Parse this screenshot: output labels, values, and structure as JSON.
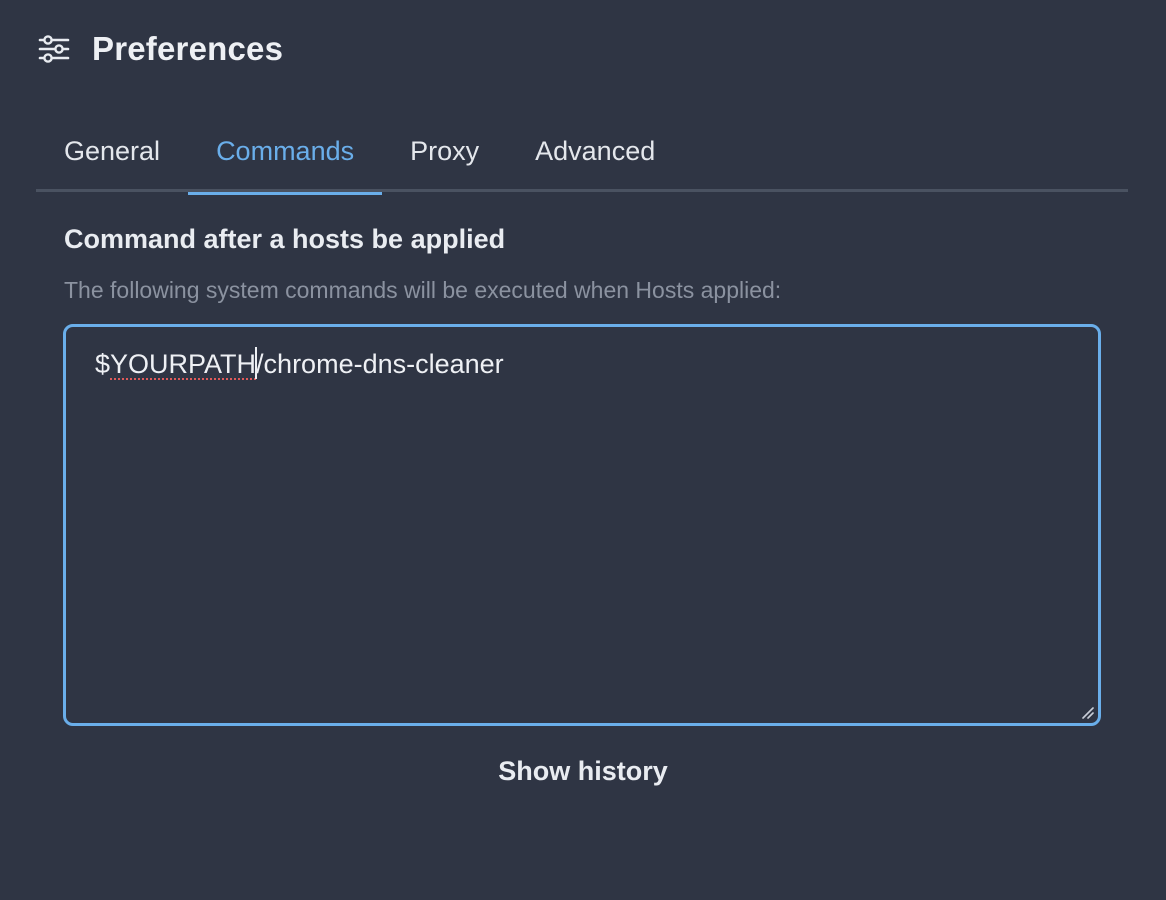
{
  "header": {
    "icon": "sliders-icon",
    "title": "Preferences"
  },
  "tabs": [
    {
      "label": "General",
      "active": false
    },
    {
      "label": "Commands",
      "active": true
    },
    {
      "label": "Proxy",
      "active": false
    },
    {
      "label": "Advanced",
      "active": false
    }
  ],
  "commands": {
    "section_title": "Command after a hosts be applied",
    "description": "The following system commands will be executed when Hosts applied:",
    "editor": {
      "prefix": "$",
      "misspelled_word": "YOURPATH",
      "suffix": "/chrome-dns-cleaner"
    },
    "show_history_label": "Show history"
  },
  "colors": {
    "background": "#2f3544",
    "accent": "#6aaeea",
    "text": "#e9ecf1",
    "muted": "#8b92a0",
    "spellcheck": "#e05a5a"
  }
}
